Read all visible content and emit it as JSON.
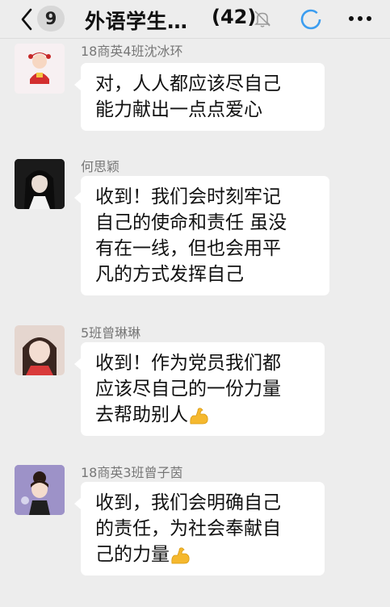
{
  "header": {
    "back_icon": "chevron-left-icon",
    "unread_count": "9",
    "title": "外语学生…",
    "member_count": "(42)",
    "mute_icon": "bell-muted-icon",
    "status_icon": "loading-ring-icon",
    "more_icon": "more-dots-icon"
  },
  "messages": [
    {
      "sender": "18商英4班沈冰环",
      "avatar": "cartoon-avatar-icon",
      "lines": [
        "对，人人都应该尽自己",
        "能力献出一点点爱心"
      ]
    },
    {
      "sender": "何思颖",
      "avatar": "photo-avatar-dark",
      "lines": [
        "收到！我们会时刻牢记",
        "自己的使命和责任 虽没",
        "有在一线，但也会用平",
        "凡的方式发挥自己"
      ]
    },
    {
      "sender": "5班曾琳琳",
      "avatar": "photo-avatar-girl",
      "lines": [
        "收到！作为党员我们都",
        "应该尽自己的一份力量",
        "去帮助别人"
      ],
      "emoji": "flexed-biceps-icon"
    },
    {
      "sender": "18商英3班曾子茵",
      "avatar": "illustrated-avatar",
      "lines": [
        "收到，我们会明确自己",
        "的责任，为社会奉献自",
        "己的力量"
      ],
      "emoji": "flexed-biceps-icon"
    }
  ],
  "colors": {
    "background": "#ededed",
    "bubble": "#ffffff",
    "loading_ring": "#3b9df0",
    "emoji": "#f5b82e"
  }
}
